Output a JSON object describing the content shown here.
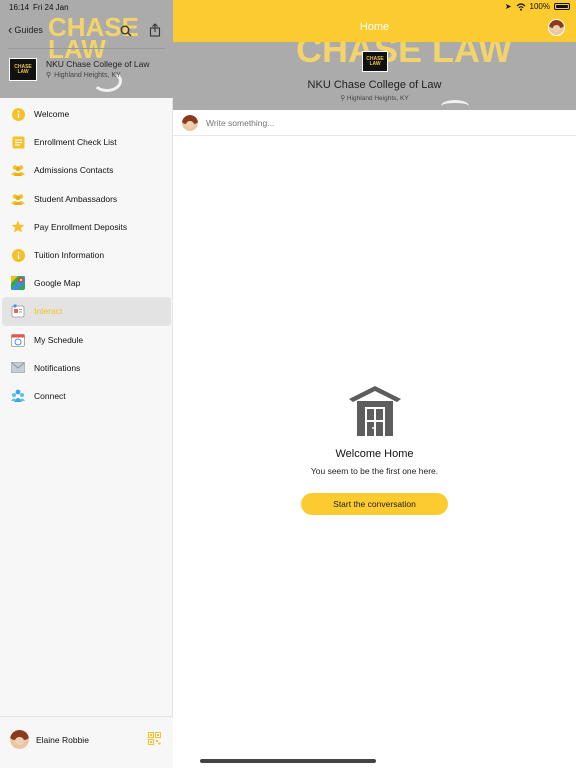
{
  "status": {
    "time": "16:14",
    "date": "Fri 24 Jan",
    "battery": "100%"
  },
  "sidebar": {
    "back_label": "Guides",
    "banner_text": "CHASE LAW",
    "logo_text": "CHASE LAW",
    "org_name": "NKU Chase College of Law",
    "location": "Highland Heights, KY",
    "items": [
      {
        "label": "Welcome",
        "icon": "info-icon"
      },
      {
        "label": "Enrollment Check List",
        "icon": "checklist-icon"
      },
      {
        "label": "Admissions Contacts",
        "icon": "people-icon"
      },
      {
        "label": "Student Ambassadors",
        "icon": "people-icon"
      },
      {
        "label": "Pay Enrollment Deposits",
        "icon": "star-icon"
      },
      {
        "label": "Tuition Information",
        "icon": "info-icon"
      },
      {
        "label": "Google Map",
        "icon": "map-icon"
      },
      {
        "label": "Interact",
        "icon": "interact-icon"
      },
      {
        "label": "My Schedule",
        "icon": "calendar-icon"
      },
      {
        "label": "Notifications",
        "icon": "mail-icon"
      },
      {
        "label": "Connect",
        "icon": "connect-icon"
      }
    ],
    "active_item": "Interact",
    "user_name": "Elaine Robbie"
  },
  "main": {
    "title": "Home",
    "banner_text": "CHASE LAW",
    "org_name": "NKU Chase College of Law",
    "location": "Highland Heights, KY",
    "composer_placeholder": "Write something...",
    "empty_title": "Welcome Home",
    "empty_subtitle": "You seem to be the first one here.",
    "cta_label": "Start the conversation"
  },
  "colors": {
    "accent": "#fccb2f",
    "banner_gray": "#ababab",
    "active_bg": "#e3e3e3"
  }
}
